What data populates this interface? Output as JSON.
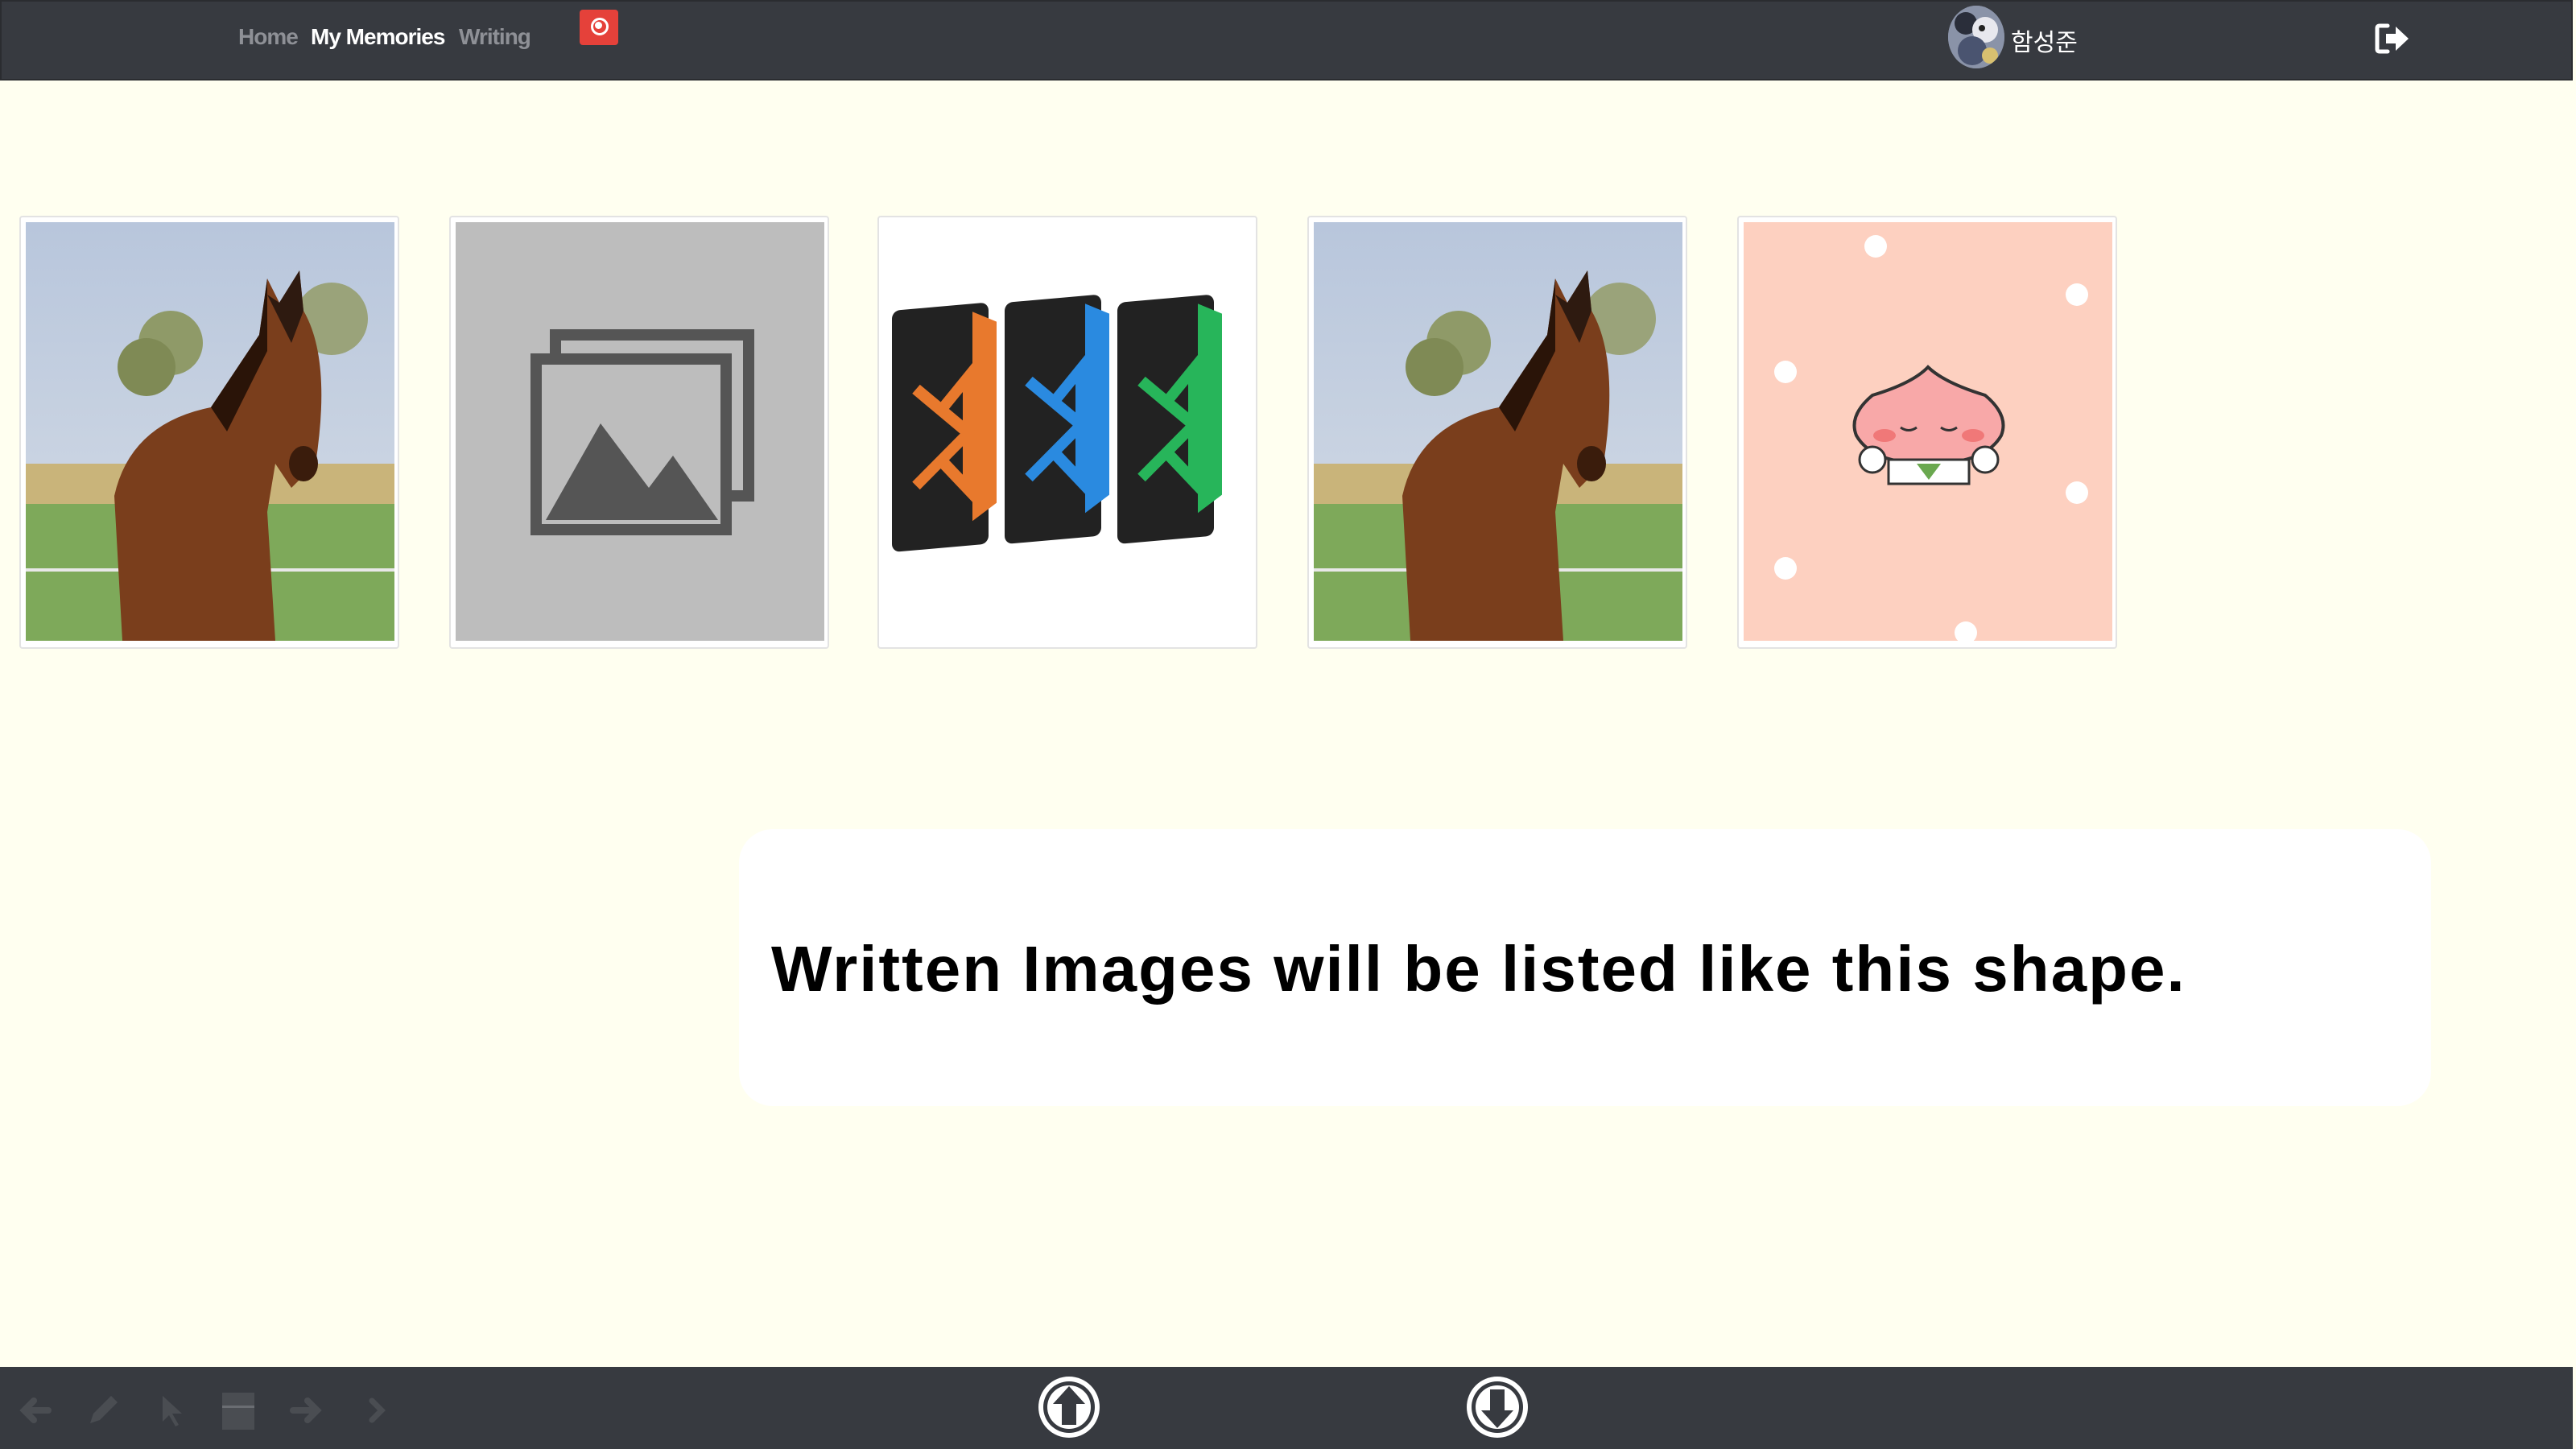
{
  "navbar": {
    "links": [
      {
        "label": "Home",
        "active": false
      },
      {
        "label": "My Memories",
        "active": true
      },
      {
        "label": "Writing",
        "active": false
      }
    ],
    "camera_icon": "camera-icon",
    "user": {
      "name": "함성준",
      "avatar": "avatar-image"
    },
    "logout_icon": "logout-icon"
  },
  "gallery": {
    "cards": [
      {
        "image": "horse-photo"
      },
      {
        "image": "image-placeholder"
      },
      {
        "image": "vscode-icons"
      },
      {
        "image": "horse-photo"
      },
      {
        "image": "peach-character"
      }
    ]
  },
  "message": {
    "text": "Written Images will be listed like this shape."
  },
  "toolbar": {
    "tools": [
      "back-arrow-icon",
      "pencil-icon",
      "pointer-icon",
      "eraser-icon",
      "forward-arrow-icon",
      "chevron-right-icon"
    ],
    "scroll_up_icon": "arrow-up-circle-icon",
    "scroll_down_icon": "arrow-down-circle-icon"
  },
  "colors": {
    "navbar_bg": "#373a40",
    "page_bg": "#fffff0",
    "camera_red": "#e5413a",
    "nav_inactive": "#8e9096",
    "nav_active": "#ffffff"
  }
}
